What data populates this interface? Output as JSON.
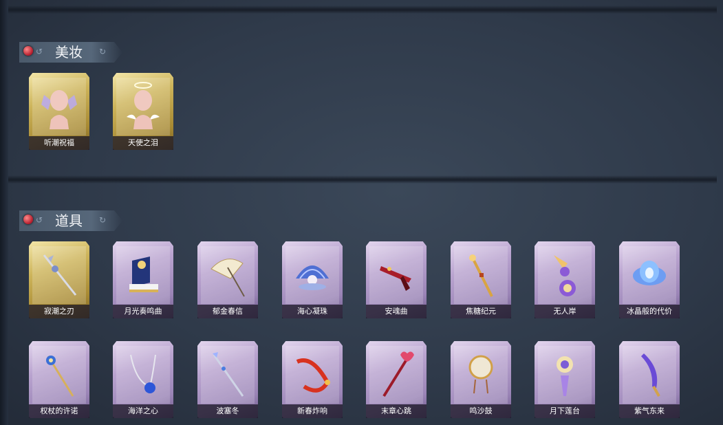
{
  "sections": [
    {
      "title": "美妆",
      "items": [
        {
          "label": "听潮祝福",
          "rarity": "gold",
          "icon": "head-with-wings-icon"
        },
        {
          "label": "天使之泪",
          "rarity": "gold",
          "icon": "head-with-halo-icon"
        }
      ]
    },
    {
      "title": "道具",
      "items": [
        {
          "label": "寂潮之刃",
          "rarity": "gold",
          "icon": "ornate-blade-icon"
        },
        {
          "label": "月光奏鸣曲",
          "rarity": "purple",
          "icon": "piano-icon"
        },
        {
          "label": "郁金春信",
          "rarity": "purple",
          "icon": "parasol-icon"
        },
        {
          "label": "海心凝珠",
          "rarity": "purple",
          "icon": "pearl-shell-icon"
        },
        {
          "label": "安魂曲",
          "rarity": "purple",
          "icon": "red-sword-icon"
        },
        {
          "label": "焦糖纪元",
          "rarity": "purple",
          "icon": "golden-staff-icon"
        },
        {
          "label": "无人岸",
          "rarity": "purple",
          "icon": "perfume-bottle-icon"
        },
        {
          "label": "冰晶般的代价",
          "rarity": "purple",
          "icon": "ice-lotus-icon"
        },
        {
          "label": "权杖的许诺",
          "rarity": "purple",
          "icon": "scepter-icon"
        },
        {
          "label": "海洋之心",
          "rarity": "purple",
          "icon": "gem-necklace-icon"
        },
        {
          "label": "波塞冬",
          "rarity": "purple",
          "icon": "trident-icon"
        },
        {
          "label": "新春炸响",
          "rarity": "purple",
          "icon": "firecracker-icon"
        },
        {
          "label": "末章心跳",
          "rarity": "purple",
          "icon": "heart-wand-icon"
        },
        {
          "label": "鸣沙鼓",
          "rarity": "purple",
          "icon": "drum-icon"
        },
        {
          "label": "月下莲台",
          "rarity": "purple",
          "icon": "lotus-lantern-icon"
        },
        {
          "label": "紫气东来",
          "rarity": "purple",
          "icon": "purple-blade-icon"
        }
      ]
    }
  ],
  "colors": {
    "gold_frame": "#cdb45a",
    "purple_frame": "#b9a3cf",
    "background": "#2f3a4a",
    "label_bg": "#1e1a28"
  }
}
